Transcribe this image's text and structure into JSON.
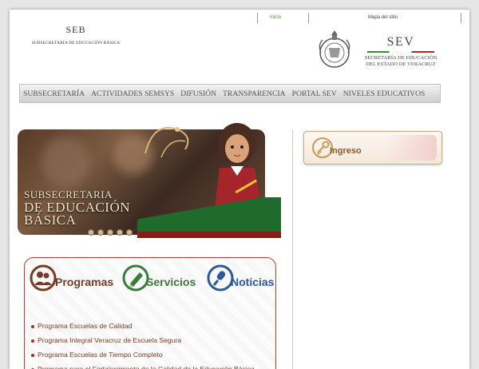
{
  "header": {
    "links": {
      "home": "Inicio",
      "sitemap": "Mapa del sitio"
    },
    "seb": {
      "abbr": "SEB",
      "full": "SUBSECRETARÍA DE EDUCACIÓN BÁSICA"
    },
    "sev": {
      "abbr": "SEV",
      "full_line1": "SECRETARÍA DE EDUCACIÓN",
      "full_line2": "DEL ESTADO DE VERACRUZ"
    }
  },
  "nav": {
    "items": [
      "SUBSECRETARÍA",
      "ACTIVIDADES SEMSYS",
      "DIFUSIÓN",
      "TRANSPARENCIA",
      "PORTAL SEV",
      "NIVELES EDUCATIVOS"
    ]
  },
  "banner": {
    "line1": "SUBSECRETARIA",
    "line2": "DE EDUCACIÓN",
    "line3": "BÁSICA",
    "slide_count": 5
  },
  "login": {
    "label": "Ingreso"
  },
  "tabs": {
    "programas": "Programas",
    "servicios": "Servicios",
    "noticias": "Noticias"
  },
  "programs": [
    "Programa Escuelas de Calidad",
    "Programa Integral Veracruz de Escuela Segura",
    "Programa Escuelas de Tiempo Completo",
    "Programa para el Fortalecimiento de la Calidad de la Educación Básica"
  ],
  "colors": {
    "accent_brown": "#7b3a22",
    "accent_red": "#b02a2a",
    "accent_green": "#1f6b2b",
    "noticias_blue": "#2a5a9a",
    "servicios_green": "#3a7a3a"
  }
}
